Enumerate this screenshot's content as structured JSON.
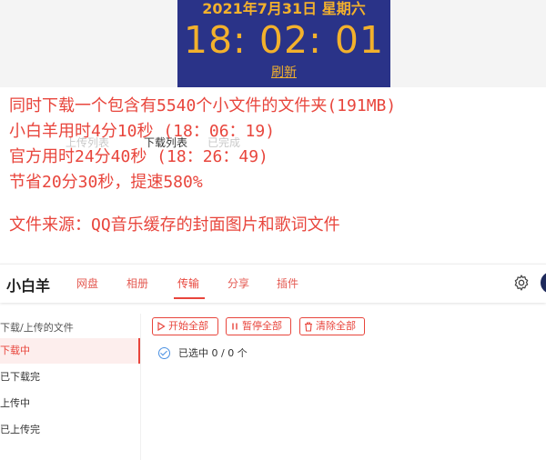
{
  "clock": {
    "date": "2021年7月31日 星期六",
    "time": "18: 02: 01",
    "refresh": "刷新"
  },
  "background_tabs": [
    "上传列表",
    "下载列表",
    "已完成"
  ],
  "overlay_lines": [
    "同时下载一个包含有5540个小文件的文件夹(191MB)",
    "小白羊用时4分10秒 (18：06：19)",
    "官方用时24分40秒 (18：26：49)",
    "节省20分30秒，提速580%",
    "",
    "文件来源：QQ音乐缓存的封面图片和歌词文件"
  ],
  "app": {
    "name": "小白羊",
    "nav": [
      "网盘",
      "相册",
      "传输",
      "分享",
      "插件"
    ],
    "active_nav": "传输"
  },
  "sidebar": {
    "title": "下载/上传的文件",
    "items": [
      "下载中",
      "已下载完",
      "上传中",
      "已上传完"
    ]
  },
  "toolbar": {
    "start_all": "开始全部",
    "pause_all": "暂停全部",
    "clear_all": "清除全部"
  },
  "selection": {
    "text": "已选中 0 / 0 个"
  },
  "colors": {
    "accent": "#e8453c",
    "clock_bg": "#2a3388",
    "clock_text": "#f3b12c"
  }
}
